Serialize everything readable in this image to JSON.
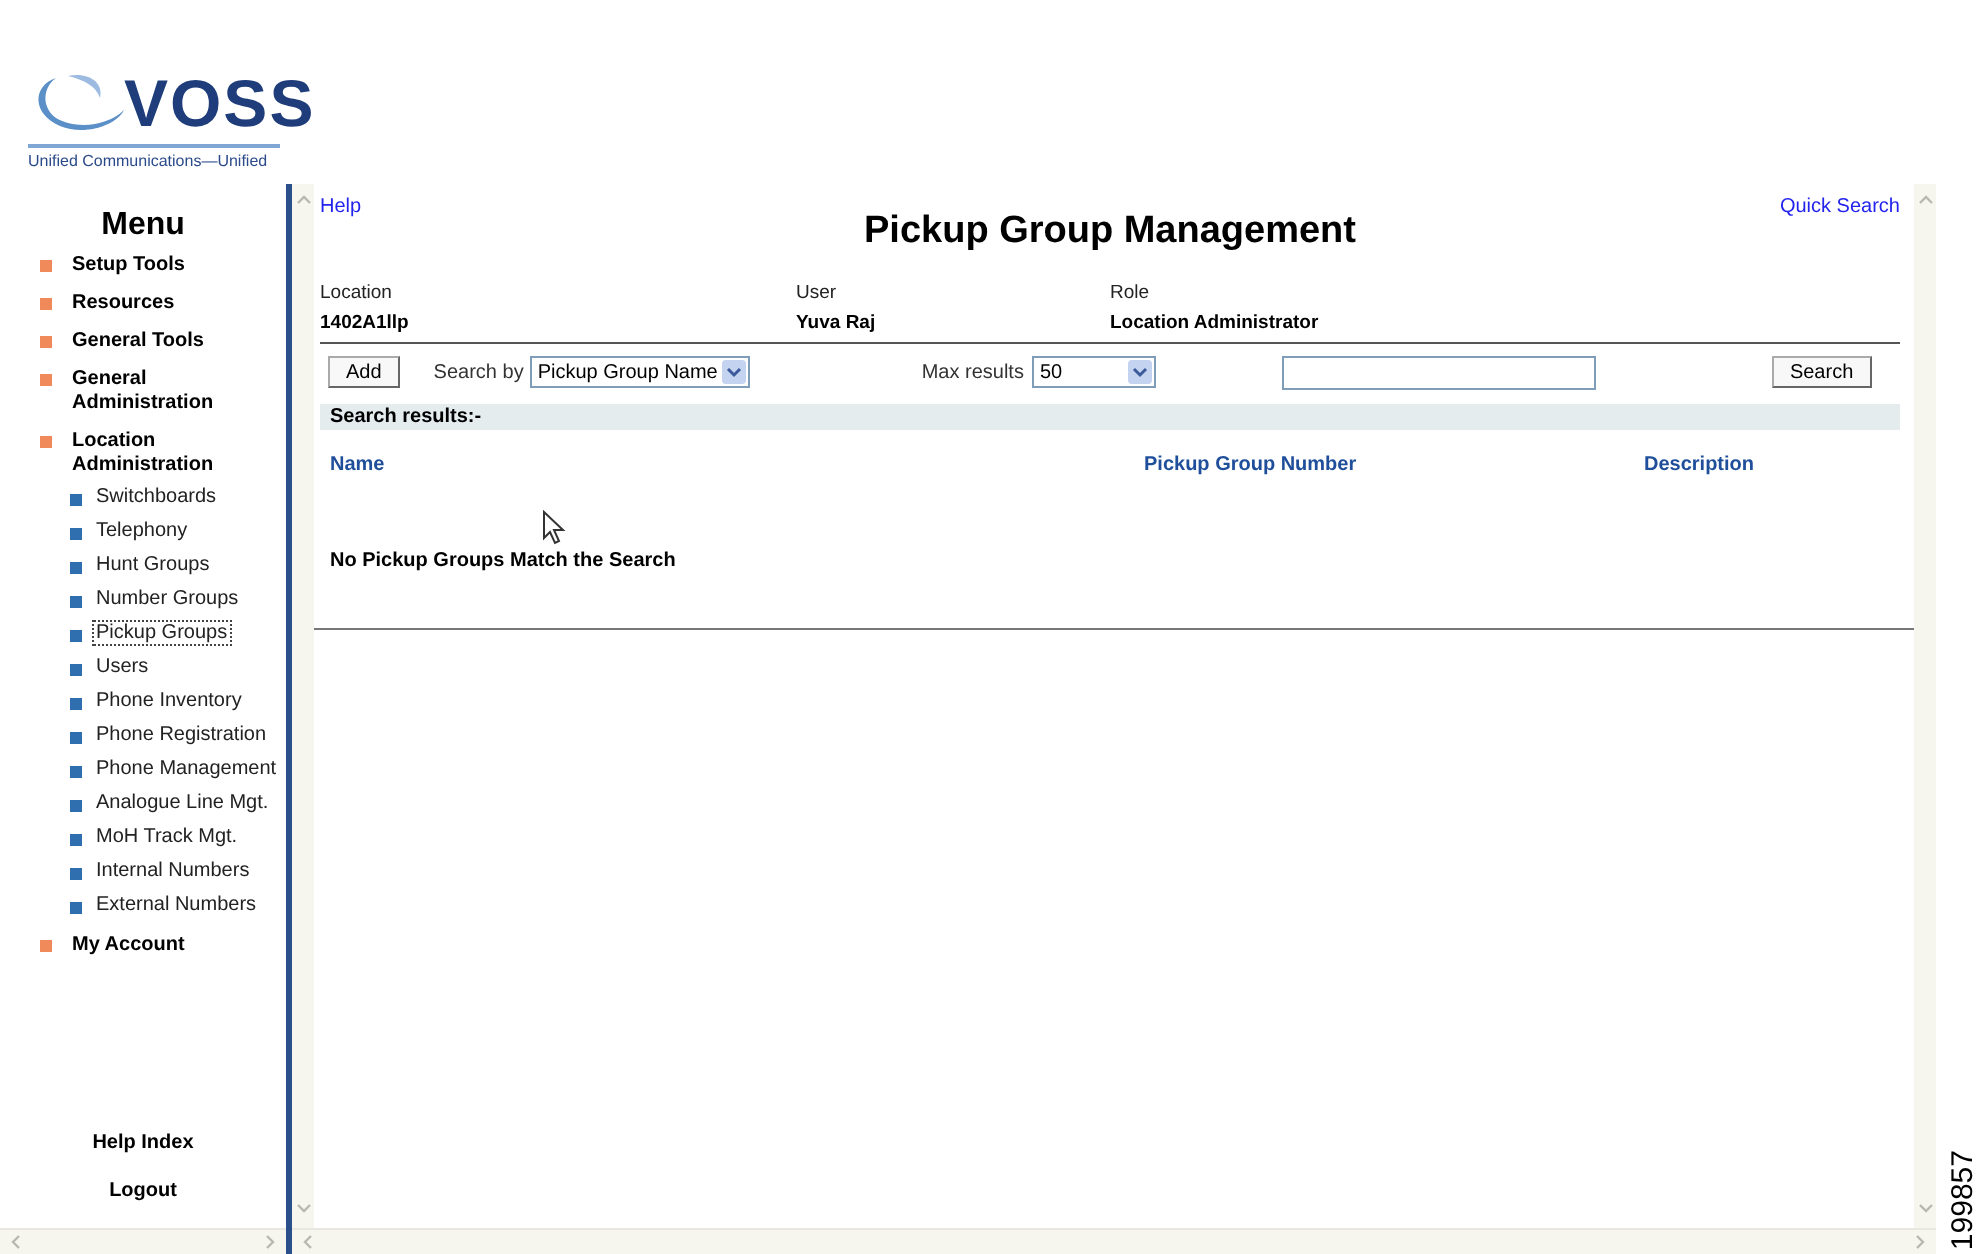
{
  "logo": {
    "name": "VOSS",
    "tagline": "Unified Communications—Unified"
  },
  "menu": {
    "title": "Menu",
    "items": [
      {
        "label": "Setup Tools"
      },
      {
        "label": "Resources"
      },
      {
        "label": "General Tools"
      },
      {
        "label": "General Administration"
      },
      {
        "label": "Location Administration",
        "children": [
          {
            "label": "Switchboards",
            "selected": false
          },
          {
            "label": "Telephony",
            "selected": false
          },
          {
            "label": "Hunt Groups",
            "selected": false
          },
          {
            "label": "Number Groups",
            "selected": false
          },
          {
            "label": "Pickup Groups",
            "selected": true
          },
          {
            "label": "Users",
            "selected": false
          },
          {
            "label": "Phone Inventory",
            "selected": false
          },
          {
            "label": "Phone Registration",
            "selected": false
          },
          {
            "label": "Phone Management",
            "selected": false
          },
          {
            "label": "Analogue Line Mgt.",
            "selected": false
          },
          {
            "label": "MoH Track Mgt.",
            "selected": false
          },
          {
            "label": "Internal Numbers",
            "selected": false
          },
          {
            "label": "External Numbers",
            "selected": false
          }
        ]
      },
      {
        "label": "My Account"
      }
    ],
    "footer_links": [
      "Help Index",
      "Logout"
    ]
  },
  "help_link": "Help",
  "quick_search_link": "Quick Search",
  "title": "Pickup Group Management",
  "info": [
    {
      "label": "Location",
      "value": "1402A1llp"
    },
    {
      "label": "User",
      "value": "Yuva Raj"
    },
    {
      "label": "Role",
      "value": "Location Administrator"
    }
  ],
  "toolbar": {
    "add_button": "Add",
    "search_by_label": "Search by",
    "search_by_value": "Pickup Group Name",
    "max_results_label": "Max results",
    "max_results_value": "50",
    "search_button": "Search"
  },
  "results": {
    "header": "Search results:-",
    "columns": [
      "Name",
      "Pickup Group Number",
      "Description"
    ],
    "empty_message": "No Pickup Groups Match the Search"
  },
  "figure_id": "199857"
}
